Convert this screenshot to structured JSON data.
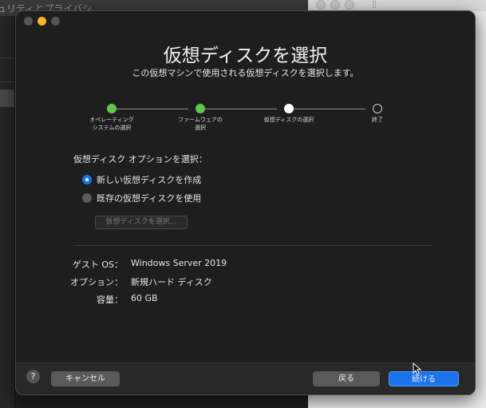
{
  "background": {
    "window_title": "ュリティとプライバシ"
  },
  "dialog": {
    "title": "仮想ディスクを選択",
    "subtitle": "この仮想マシンで使用される仮想ディスクを選択します。",
    "steps": [
      {
        "label": "オペレーティング\nシステムの選択",
        "state": "done"
      },
      {
        "label": "ファームウェアの\n選択",
        "state": "done"
      },
      {
        "label": "仮想ディスクの選択",
        "state": "current"
      },
      {
        "label": "終了",
        "state": "todo"
      }
    ],
    "section_label": "仮想ディスク オプションを選択：",
    "options": [
      {
        "label": "新しい仮想ディスクを作成",
        "selected": true
      },
      {
        "label": "既存の仮想ディスクを使用",
        "selected": false
      }
    ],
    "choose_disk_button": "仮想ディスクを選択...",
    "info": [
      {
        "key": "ゲスト OS：",
        "value": "Windows Server 2019"
      },
      {
        "key": "オプション：",
        "value": "新規ハード ディスク"
      },
      {
        "key": "容量：",
        "value": "60 GB"
      }
    ],
    "footer": {
      "help": "?",
      "cancel": "キャンセル",
      "back": "戻る",
      "continue": "続ける"
    }
  },
  "colors": {
    "accent": "#1a73e8",
    "step_done": "#5fc84b",
    "minimize": "#f4b52b"
  }
}
